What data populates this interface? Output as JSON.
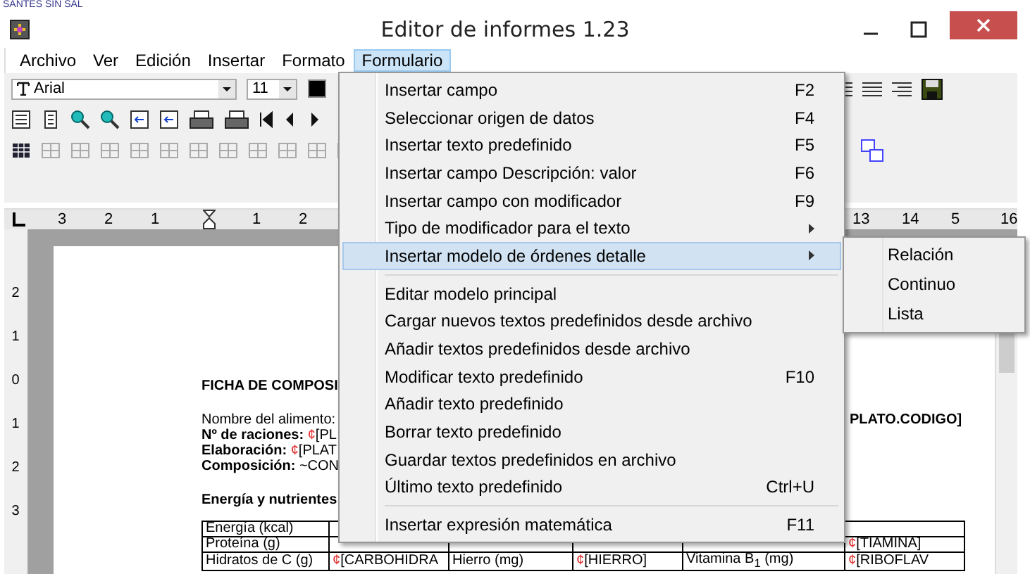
{
  "background_window": {
    "text": "SANTES SIN SAL"
  },
  "window": {
    "title": "Editor de informes 1.23"
  },
  "menu_bar": [
    {
      "label": "Archivo",
      "selected": false
    },
    {
      "label": "Ver",
      "selected": false
    },
    {
      "label": "Edición",
      "selected": false
    },
    {
      "label": "Insertar",
      "selected": false
    },
    {
      "label": "Formato",
      "selected": false
    },
    {
      "label": "Formulario",
      "selected": true
    }
  ],
  "toolbar": {
    "font": "Arial",
    "size": "11"
  },
  "ruler": {
    "left_numbers": [
      "3",
      "2",
      "1",
      "1",
      "2"
    ],
    "right_numbers": [
      "13",
      "14",
      "5",
      "16"
    ],
    "vertical_numbers": [
      "2",
      "1",
      "0",
      "1",
      "2",
      "3"
    ]
  },
  "document": {
    "heading": "FICHA DE COMPOSI",
    "lines": [
      {
        "label": "Nombre del alimento:",
        "bold": false
      },
      {
        "label": "Nº de raciones:",
        "bold": true,
        "marker": "¢",
        "value": "[PL"
      },
      {
        "label": "Elaboración:",
        "bold": true,
        "marker": "¢",
        "value": "[PLAT"
      },
      {
        "label": "Composición:",
        "bold": true,
        "value": "~CON"
      }
    ],
    "code_field": "PLATO.CODIGO]",
    "section": "Energía y nutrientes",
    "table_rows": [
      [
        {
          "text": "Energía (kcal)"
        },
        null,
        null,
        null,
        null,
        null
      ],
      [
        {
          "text": "Proteína (g)"
        },
        null,
        null,
        null,
        null,
        {
          "marker": "¢",
          "text": "[TIAMINA]"
        }
      ],
      [
        {
          "text": "Hidratos de C (g)"
        },
        {
          "marker": "¢",
          "text": "[CARBOHIDRA"
        },
        {
          "text": "Hierro (mg)"
        },
        {
          "marker": "¢",
          "text": "[HIERRO]"
        },
        {
          "text": "Vitamina B$_{1}$ (mg)"
        },
        {
          "marker": "¢",
          "text": "[RIBOFLAV"
        }
      ]
    ]
  },
  "menu": {
    "groups": [
      [
        {
          "label": "Insertar campo",
          "shortcut": "F2",
          "submenu": false,
          "selected": false
        },
        {
          "label": "Seleccionar origen de datos",
          "shortcut": "F4",
          "submenu": false,
          "selected": false
        },
        {
          "label": "Insertar texto predefinido",
          "shortcut": "F5",
          "submenu": false,
          "selected": false
        },
        {
          "label": "Insertar campo Descripción: valor",
          "shortcut": "F6",
          "submenu": false,
          "selected": false
        },
        {
          "label": "Insertar campo con modificador",
          "shortcut": "F9",
          "submenu": false,
          "selected": false
        },
        {
          "label": "Tipo de modificador para el texto",
          "submenu": true,
          "selected": false
        },
        {
          "label": "Insertar modelo de órdenes detalle",
          "submenu": true,
          "selected": true
        }
      ],
      [
        {
          "label": "Editar modelo principal",
          "submenu": false,
          "selected": false
        },
        {
          "label": "Cargar nuevos textos predefinidos desde archivo",
          "submenu": false,
          "selected": false
        },
        {
          "label": "Añadir textos predefinidos desde archivo",
          "submenu": false,
          "selected": false
        },
        {
          "label": "Modificar texto predefinido",
          "shortcut": "F10",
          "submenu": false,
          "selected": false
        },
        {
          "label": "Añadir texto predefinido",
          "submenu": false,
          "selected": false
        },
        {
          "label": "Borrar texto predefinido",
          "submenu": false,
          "selected": false
        },
        {
          "label": "Guardar textos predefinidos en archivo",
          "submenu": false,
          "selected": false
        },
        {
          "label": "Último texto predefinido",
          "shortcut": "Ctrl+U",
          "submenu": false,
          "selected": false
        }
      ],
      [
        {
          "label": "Insertar expresión matemática",
          "shortcut": "F11",
          "submenu": false,
          "selected": false
        }
      ]
    ]
  },
  "submenu": [
    {
      "label": "Relación"
    },
    {
      "label": "Continuo"
    },
    {
      "label": "Lista"
    }
  ]
}
